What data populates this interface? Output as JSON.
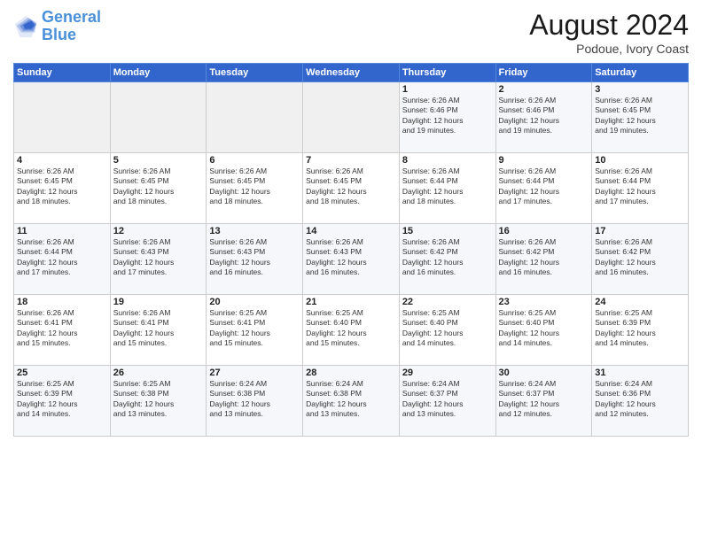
{
  "logo": {
    "line1": "General",
    "line2": "Blue"
  },
  "title": "August 2024",
  "location": "Podoue, Ivory Coast",
  "days_header": [
    "Sunday",
    "Monday",
    "Tuesday",
    "Wednesday",
    "Thursday",
    "Friday",
    "Saturday"
  ],
  "weeks": [
    [
      {
        "num": "",
        "info": ""
      },
      {
        "num": "",
        "info": ""
      },
      {
        "num": "",
        "info": ""
      },
      {
        "num": "",
        "info": ""
      },
      {
        "num": "1",
        "info": "Sunrise: 6:26 AM\nSunset: 6:46 PM\nDaylight: 12 hours\nand 19 minutes."
      },
      {
        "num": "2",
        "info": "Sunrise: 6:26 AM\nSunset: 6:46 PM\nDaylight: 12 hours\nand 19 minutes."
      },
      {
        "num": "3",
        "info": "Sunrise: 6:26 AM\nSunset: 6:45 PM\nDaylight: 12 hours\nand 19 minutes."
      }
    ],
    [
      {
        "num": "4",
        "info": "Sunrise: 6:26 AM\nSunset: 6:45 PM\nDaylight: 12 hours\nand 18 minutes."
      },
      {
        "num": "5",
        "info": "Sunrise: 6:26 AM\nSunset: 6:45 PM\nDaylight: 12 hours\nand 18 minutes."
      },
      {
        "num": "6",
        "info": "Sunrise: 6:26 AM\nSunset: 6:45 PM\nDaylight: 12 hours\nand 18 minutes."
      },
      {
        "num": "7",
        "info": "Sunrise: 6:26 AM\nSunset: 6:45 PM\nDaylight: 12 hours\nand 18 minutes."
      },
      {
        "num": "8",
        "info": "Sunrise: 6:26 AM\nSunset: 6:44 PM\nDaylight: 12 hours\nand 18 minutes."
      },
      {
        "num": "9",
        "info": "Sunrise: 6:26 AM\nSunset: 6:44 PM\nDaylight: 12 hours\nand 17 minutes."
      },
      {
        "num": "10",
        "info": "Sunrise: 6:26 AM\nSunset: 6:44 PM\nDaylight: 12 hours\nand 17 minutes."
      }
    ],
    [
      {
        "num": "11",
        "info": "Sunrise: 6:26 AM\nSunset: 6:44 PM\nDaylight: 12 hours\nand 17 minutes."
      },
      {
        "num": "12",
        "info": "Sunrise: 6:26 AM\nSunset: 6:43 PM\nDaylight: 12 hours\nand 17 minutes."
      },
      {
        "num": "13",
        "info": "Sunrise: 6:26 AM\nSunset: 6:43 PM\nDaylight: 12 hours\nand 16 minutes."
      },
      {
        "num": "14",
        "info": "Sunrise: 6:26 AM\nSunset: 6:43 PM\nDaylight: 12 hours\nand 16 minutes."
      },
      {
        "num": "15",
        "info": "Sunrise: 6:26 AM\nSunset: 6:42 PM\nDaylight: 12 hours\nand 16 minutes."
      },
      {
        "num": "16",
        "info": "Sunrise: 6:26 AM\nSunset: 6:42 PM\nDaylight: 12 hours\nand 16 minutes."
      },
      {
        "num": "17",
        "info": "Sunrise: 6:26 AM\nSunset: 6:42 PM\nDaylight: 12 hours\nand 16 minutes."
      }
    ],
    [
      {
        "num": "18",
        "info": "Sunrise: 6:26 AM\nSunset: 6:41 PM\nDaylight: 12 hours\nand 15 minutes."
      },
      {
        "num": "19",
        "info": "Sunrise: 6:26 AM\nSunset: 6:41 PM\nDaylight: 12 hours\nand 15 minutes."
      },
      {
        "num": "20",
        "info": "Sunrise: 6:25 AM\nSunset: 6:41 PM\nDaylight: 12 hours\nand 15 minutes."
      },
      {
        "num": "21",
        "info": "Sunrise: 6:25 AM\nSunset: 6:40 PM\nDaylight: 12 hours\nand 15 minutes."
      },
      {
        "num": "22",
        "info": "Sunrise: 6:25 AM\nSunset: 6:40 PM\nDaylight: 12 hours\nand 14 minutes."
      },
      {
        "num": "23",
        "info": "Sunrise: 6:25 AM\nSunset: 6:40 PM\nDaylight: 12 hours\nand 14 minutes."
      },
      {
        "num": "24",
        "info": "Sunrise: 6:25 AM\nSunset: 6:39 PM\nDaylight: 12 hours\nand 14 minutes."
      }
    ],
    [
      {
        "num": "25",
        "info": "Sunrise: 6:25 AM\nSunset: 6:39 PM\nDaylight: 12 hours\nand 14 minutes."
      },
      {
        "num": "26",
        "info": "Sunrise: 6:25 AM\nSunset: 6:38 PM\nDaylight: 12 hours\nand 13 minutes."
      },
      {
        "num": "27",
        "info": "Sunrise: 6:24 AM\nSunset: 6:38 PM\nDaylight: 12 hours\nand 13 minutes."
      },
      {
        "num": "28",
        "info": "Sunrise: 6:24 AM\nSunset: 6:38 PM\nDaylight: 12 hours\nand 13 minutes."
      },
      {
        "num": "29",
        "info": "Sunrise: 6:24 AM\nSunset: 6:37 PM\nDaylight: 12 hours\nand 13 minutes."
      },
      {
        "num": "30",
        "info": "Sunrise: 6:24 AM\nSunset: 6:37 PM\nDaylight: 12 hours\nand 12 minutes."
      },
      {
        "num": "31",
        "info": "Sunrise: 6:24 AM\nSunset: 6:36 PM\nDaylight: 12 hours\nand 12 minutes."
      }
    ]
  ]
}
